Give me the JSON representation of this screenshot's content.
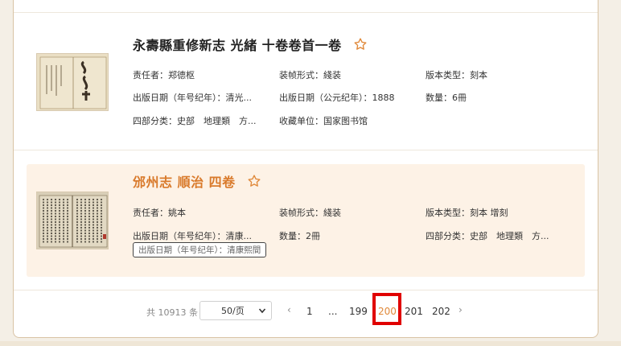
{
  "records": [
    {
      "title": "永壽縣重修新志 光緒 十卷卷首一卷",
      "fields": {
        "responsible": "责任者：郑德枢",
        "binding": "装帧形式：綫装",
        "edition": "版本类型：刻本",
        "era_date": "出版日期（年号纪年）：清光...",
        "ce_date": "出版日期（公元纪年）：1888",
        "quantity": "数量：6冊",
        "category": "四部分类：史部　地理類　方...",
        "holder": "收藏单位：国家图书馆"
      }
    },
    {
      "title": "邠州志 順治 四卷",
      "fields": {
        "responsible": "责任者：姚本",
        "binding": "装帧形式：綫装",
        "edition": "版本类型：刻本 增刻",
        "era_date": "出版日期（年号纪年）：清康...",
        "quantity": "数量：2冊",
        "category": "四部分类：史部　地理類　方..."
      },
      "tooltip": "出版日期（年号纪年）：清康熙間"
    }
  ],
  "pagination": {
    "total": "共 10913 条",
    "page_size": "50/页",
    "prev": "‹",
    "first": "1",
    "ellipsis": "...",
    "pages": [
      "199",
      "200",
      "201",
      "202"
    ],
    "current": "200",
    "next": "›"
  },
  "colors": {
    "accent": "#e0893a",
    "highlight_bg": "#fdf2e6",
    "annotation_box": "#e00000"
  }
}
